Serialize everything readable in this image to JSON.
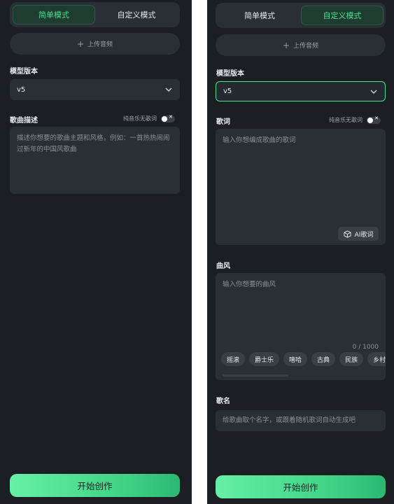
{
  "left": {
    "tabs": [
      "简单模式",
      "自定义模式"
    ],
    "active_tab": "简单模式",
    "upload_label": "上传音频",
    "model_label": "模型版本",
    "model_value": "v5",
    "desc_label": "歌曲描述",
    "instrumental_label": "纯音乐无歌词",
    "desc_placeholder": "描述你想要的歌曲主题和风格，例如：一首热热闹闹过新年的中国风歌曲",
    "create_label": "开始创作"
  },
  "right": {
    "tabs": [
      "简单模式",
      "自定义模式"
    ],
    "active_tab": "自定义模式",
    "upload_label": "上传音频",
    "model_label": "模型版本",
    "model_value": "v5",
    "lyrics_label": "歌词",
    "instrumental_label": "纯音乐无歌词",
    "lyrics_placeholder": "输入你想编成歌曲的歌词",
    "ai_lyrics_label": "AI歌词",
    "style_label": "曲风",
    "style_placeholder": "输入你想要的曲风",
    "style_counter": "0 / 1000",
    "style_chips": [
      "摇滚",
      "爵士乐",
      "嘻哈",
      "古典",
      "民族",
      "乡村"
    ],
    "song_name_label": "歌名",
    "song_name_placeholder": "给歌曲取个名字，或跟着随机歌词自动生成吧",
    "create_label": "开始创作"
  },
  "colors": {
    "panel_bg": "#1b1e23",
    "field_bg": "#2a2e35",
    "accent": "#4be08f"
  },
  "icons": [
    "plus-icon",
    "chevron-down-icon",
    "close-icon",
    "ai-cube-icon"
  ]
}
